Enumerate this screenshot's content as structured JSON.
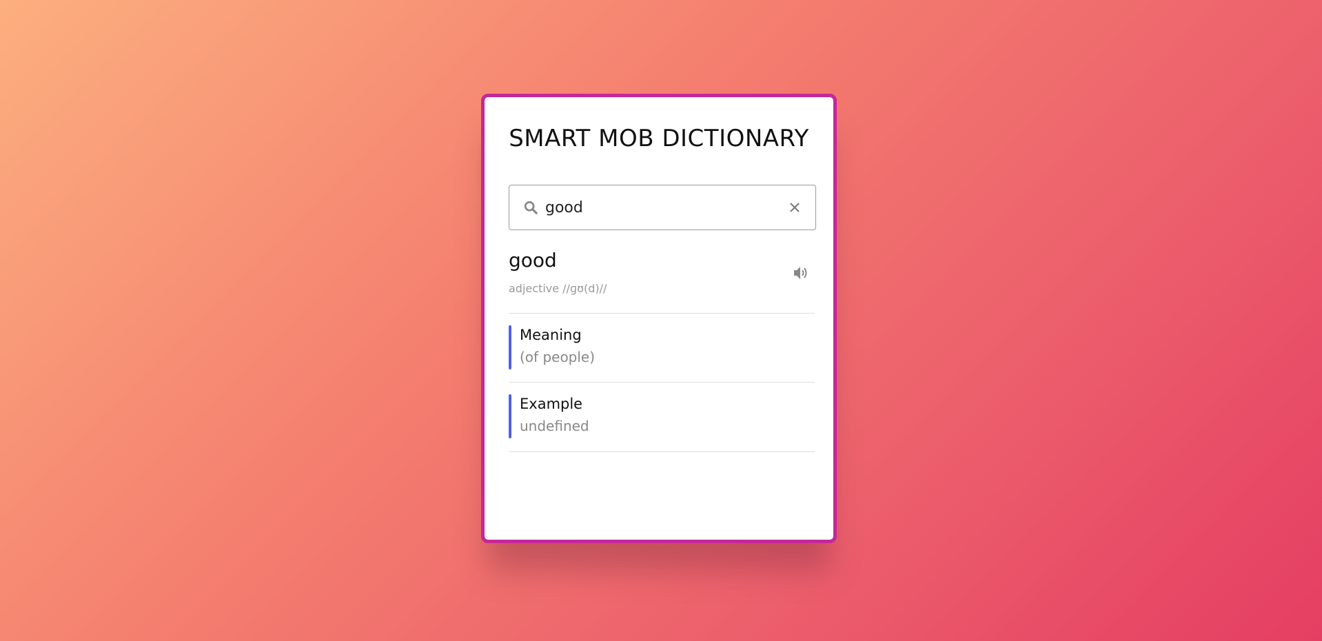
{
  "app": {
    "title": "SMART MOB DICTIONARY"
  },
  "search": {
    "value": "good",
    "placeholder": "",
    "icon": "search-icon",
    "clear_icon": "close-icon"
  },
  "result": {
    "word": "good",
    "phonetic": "adjective //ɡʊ(d)//",
    "speaker_icon": "speaker-icon"
  },
  "meaning": {
    "heading": "Meaning",
    "text": "(of people)"
  },
  "example": {
    "heading": "Example",
    "text": "undefined"
  },
  "colors": {
    "card_border": "#c5279a",
    "accent_bar": "#5060e8"
  }
}
